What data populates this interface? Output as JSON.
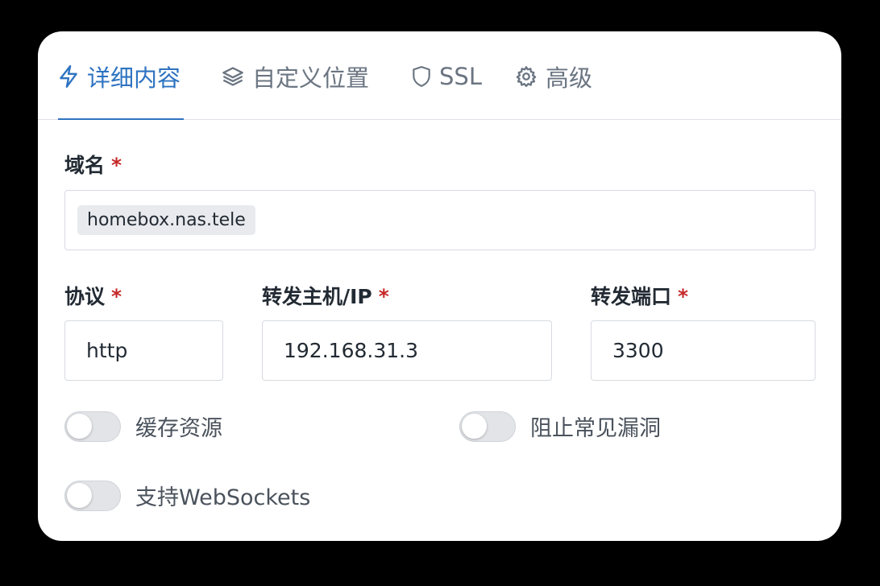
{
  "tabs": [
    {
      "label": "详细内容",
      "icon": "bolt-icon",
      "active": true
    },
    {
      "label": "自定义位置",
      "icon": "layers-icon",
      "active": false
    },
    {
      "label": "SSL",
      "icon": "shield-icon",
      "active": false
    },
    {
      "label": "高级",
      "icon": "gear-icon",
      "active": false
    }
  ],
  "domain": {
    "label": "域名",
    "required_mark": "*",
    "chips": [
      "homebox.nas.tele"
    ]
  },
  "scheme": {
    "label": "协议",
    "required_mark": "*",
    "value": "http"
  },
  "forward_host": {
    "label": "转发主机/IP",
    "required_mark": "*",
    "value": "192.168.31.3"
  },
  "forward_port": {
    "label": "转发端口",
    "required_mark": "*",
    "value": "3300"
  },
  "toggles": {
    "cache_assets": {
      "label": "缓存资源",
      "on": false
    },
    "block_exploits": {
      "label": "阻止常见漏洞",
      "on": false
    },
    "websockets": {
      "label": "支持WebSockets",
      "on": false
    }
  },
  "colors": {
    "accent": "#2e73c1",
    "required": "#c62828",
    "background": "#000000",
    "card": "#ffffff"
  }
}
